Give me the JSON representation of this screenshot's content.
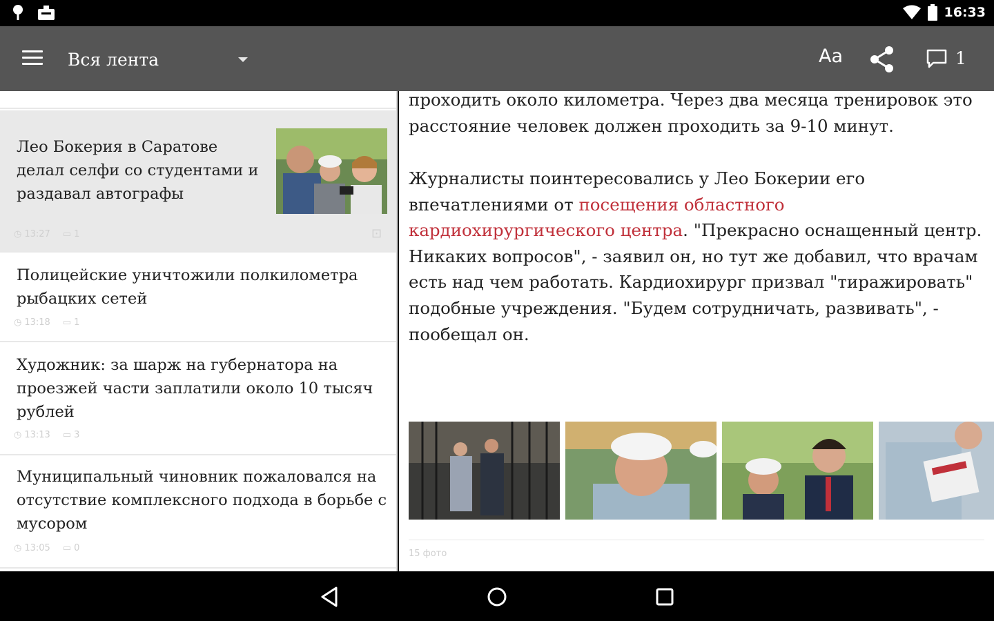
{
  "status_bar": {
    "time": "16:33",
    "icons": [
      "location-icon",
      "notification-icon",
      "wifi-icon",
      "battery-icon"
    ]
  },
  "app_bar": {
    "feed_label": "Вся лента",
    "font_button": "Aa",
    "comments_count": "1",
    "icons": [
      "menu-icon",
      "dropdown-caret-icon",
      "share-icon",
      "comment-icon"
    ]
  },
  "list": {
    "items": [
      {
        "title": "Лео Бокерия в Саратове делал селфи со студентами и раздавал автографы",
        "time": "13:27",
        "comments": "1",
        "has_photo": true
      },
      {
        "title": "Полицейские уничтожили полкилометра рыбацких сетей",
        "time": "13:18",
        "comments": "1"
      },
      {
        "title": "Художник: за шарж на губернатора на проезжей части заплатили около 10 тысяч рублей",
        "time": "13:13",
        "comments": "3"
      },
      {
        "title": "Муниципальный чиновник пожаловался на отсутствие комплексного подхода в борьбе с мусором",
        "time": "13:05",
        "comments": "0"
      }
    ]
  },
  "article": {
    "para1": "проходить около километра. Через два месяца тренировок это расстояние человек должен проходить за 9-10 минут.",
    "para2_before": "Журналисты поинтересовались у Лео Бокерии его впечатлениями от ",
    "para2_link": "посещения областного кардиохирургического центра",
    "para2_after": ". \"Прекрасно оснащенный центр. Никаких вопросов\", - заявил он, но тут же добавил, что врачам есть над чем работать. Кардиохирург призвал \"тиражировать\" подобные учреждения. \"Будем сотрудничать, развивать\", - пообещал он.",
    "photo_count": "15 фото",
    "link_color": "#c0303a"
  },
  "colors": {
    "app_bar": "#555555",
    "selected_item": "#e9e9e9",
    "link": "#c0303a"
  }
}
